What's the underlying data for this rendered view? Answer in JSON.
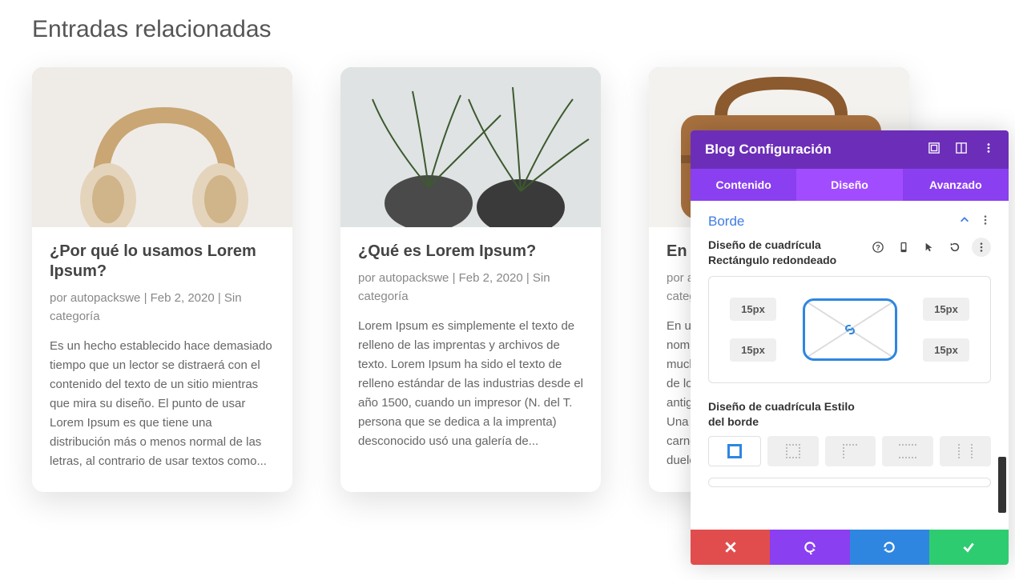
{
  "section_title": "Entradas relacionadas",
  "cards": [
    {
      "title": "¿Por qué lo usamos Lorem Ipsum?",
      "meta": "por autopackswe | Feb 2, 2020 | Sin categoría",
      "excerpt": "Es un hecho establecido hace demasiado tiempo que un lector se distraerá con el contenido del texto de un sitio mientras que mira su diseño. El punto de usar Lorem Ipsum es que tiene una distribución más o menos normal de las letras, al contrario de usar textos como..."
    },
    {
      "title": "¿Qué es Lorem Ipsum?",
      "meta": "por autopackswe | Feb 2, 2020 | Sin categoría",
      "excerpt": "Lorem Ipsum es simplemente el texto de relleno de las imprentas y archivos de texto. Lorem Ipsum ha sido el texto de relleno estándar de las industrias desde el año 1500, cuando un impresor (N. del T. persona que se dedica a la imprenta) desconocido usó una galería de..."
    },
    {
      "title": "En un",
      "meta": "por au\ncatego",
      "excerpt": "En un\nnomb\nmuch\nde los\nantigu\nUna c\ncarne\nduelo"
    }
  ],
  "panel": {
    "title": "Blog Configuración",
    "tabs": {
      "content": "Contenido",
      "design": "Diseño",
      "advanced": "Avanzado"
    },
    "section": "Borde",
    "grid_label_1": "Diseño de cuadrícula",
    "grid_label_2": "Rectángulo redondeado",
    "corners": {
      "tl": "15px",
      "tr": "15px",
      "bl": "15px",
      "br": "15px"
    },
    "border_style_label": "Diseño de cuadrícula Estilo del borde"
  }
}
